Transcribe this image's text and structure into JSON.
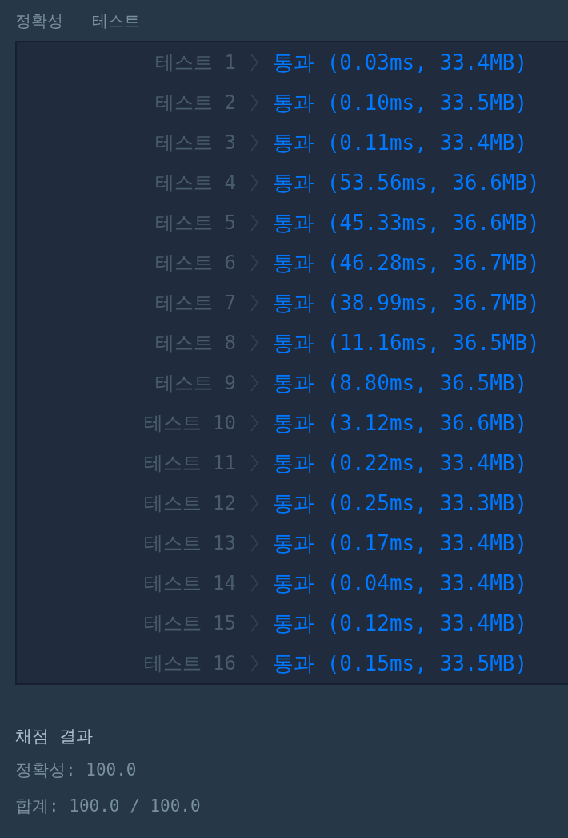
{
  "tabs": [
    "정확성",
    "테스트"
  ],
  "tests": [
    {
      "label": "테스트 1",
      "result": "통과 (0.03ms, 33.4MB)"
    },
    {
      "label": "테스트 2",
      "result": "통과 (0.10ms, 33.5MB)"
    },
    {
      "label": "테스트 3",
      "result": "통과 (0.11ms, 33.4MB)"
    },
    {
      "label": "테스트 4",
      "result": "통과 (53.56ms, 36.6MB)"
    },
    {
      "label": "테스트 5",
      "result": "통과 (45.33ms, 36.6MB)"
    },
    {
      "label": "테스트 6",
      "result": "통과 (46.28ms, 36.7MB)"
    },
    {
      "label": "테스트 7",
      "result": "통과 (38.99ms, 36.7MB)"
    },
    {
      "label": "테스트 8",
      "result": "통과 (11.16ms, 36.5MB)"
    },
    {
      "label": "테스트 9",
      "result": "통과 (8.80ms, 36.5MB)"
    },
    {
      "label": "테스트 10",
      "result": "통과 (3.12ms, 36.6MB)"
    },
    {
      "label": "테스트 11",
      "result": "통과 (0.22ms, 33.4MB)"
    },
    {
      "label": "테스트 12",
      "result": "통과 (0.25ms, 33.3MB)"
    },
    {
      "label": "테스트 13",
      "result": "통과 (0.17ms, 33.4MB)"
    },
    {
      "label": "테스트 14",
      "result": "통과 (0.04ms, 33.4MB)"
    },
    {
      "label": "테스트 15",
      "result": "통과 (0.12ms, 33.4MB)"
    },
    {
      "label": "테스트 16",
      "result": "통과 (0.15ms, 33.5MB)"
    }
  ],
  "summary": {
    "title": "채점 결과",
    "lines": [
      "정확성: 100.0",
      "합계: 100.0 / 100.0"
    ]
  }
}
